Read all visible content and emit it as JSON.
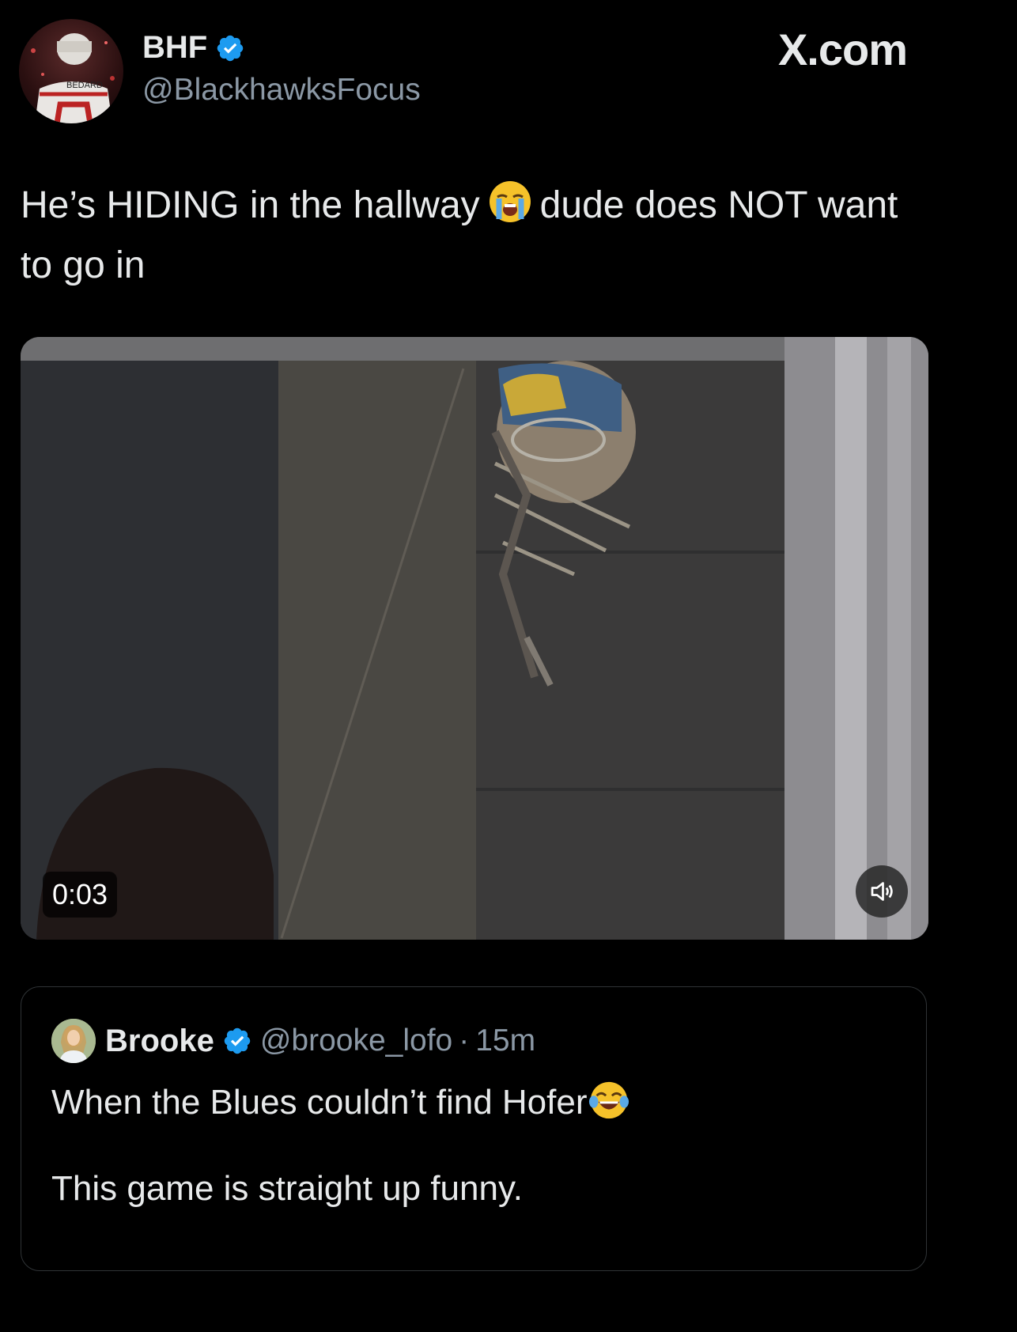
{
  "author": {
    "display_name": "BHF",
    "handle": "@BlackhawksFocus",
    "avatar_jersey_text": "BEDARD",
    "verified": true
  },
  "site_label": "X.com",
  "tweet": {
    "text_part1": "He’s HIDING in the hallway",
    "emoji_1": "loudly-crying-face",
    "text_part2": "dude does NOT want to go in"
  },
  "media": {
    "duration": "0:03",
    "volume_icon": "speaker-icon"
  },
  "quoted_tweet": {
    "display_name": "Brooke",
    "handle": "@brooke_lofo",
    "separator": "·",
    "time": "15m",
    "verified": true,
    "line1": "When the Blues couldn’t find Hofer",
    "emoji": "face-with-tears-of-joy",
    "line2": "This game is straight up funny."
  },
  "colors": {
    "background": "#000000",
    "text": "#e7e9ea",
    "muted": "#8b98a5",
    "verified_blue": "#1d9bf0",
    "border": "#2f3336"
  }
}
